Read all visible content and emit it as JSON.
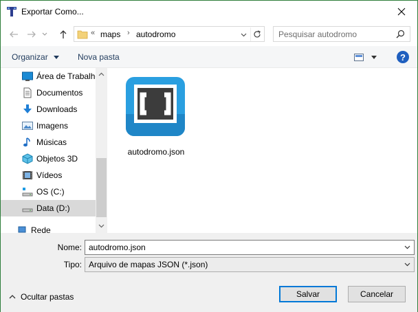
{
  "window": {
    "title": "Exportar Como..."
  },
  "address": {
    "overflow": "«",
    "segments": [
      "maps",
      "autodromo"
    ]
  },
  "search": {
    "placeholder": "Pesquisar autodromo"
  },
  "toolbar": {
    "organize_label": "Organizar",
    "new_folder_label": "Nova pasta"
  },
  "navpane": {
    "items": [
      {
        "label": "Área de Trabalho",
        "icon": "desktop-icon"
      },
      {
        "label": "Documentos",
        "icon": "documents-icon"
      },
      {
        "label": "Downloads",
        "icon": "downloads-icon"
      },
      {
        "label": "Imagens",
        "icon": "pictures-icon"
      },
      {
        "label": "Músicas",
        "icon": "music-icon"
      },
      {
        "label": "Objetos 3D",
        "icon": "3d-objects-icon"
      },
      {
        "label": "Vídeos",
        "icon": "videos-icon"
      },
      {
        "label": "OS (C:)",
        "icon": "drive-c-icon"
      },
      {
        "label": "Data (D:)",
        "icon": "drive-d-icon",
        "selected": true
      },
      {
        "label": "Rede",
        "icon": "network-icon"
      }
    ]
  },
  "files": [
    {
      "name": "autodromo.json",
      "icon": "brackets-app-icon"
    }
  ],
  "form": {
    "name_label": "Nome:",
    "name_value": "autodromo.json",
    "type_label": "Tipo:",
    "type_value": "Arquivo de mapas JSON (*.json)"
  },
  "footer": {
    "hide_folders_label": "Ocultar pastas",
    "save_label": "Salvar",
    "cancel_label": "Cancelar"
  },
  "colors": {
    "accent": "#0078d7",
    "selection": "#d9d9d9",
    "help": "#1f5fbf",
    "brackets_blue": "#2a9fe0"
  }
}
